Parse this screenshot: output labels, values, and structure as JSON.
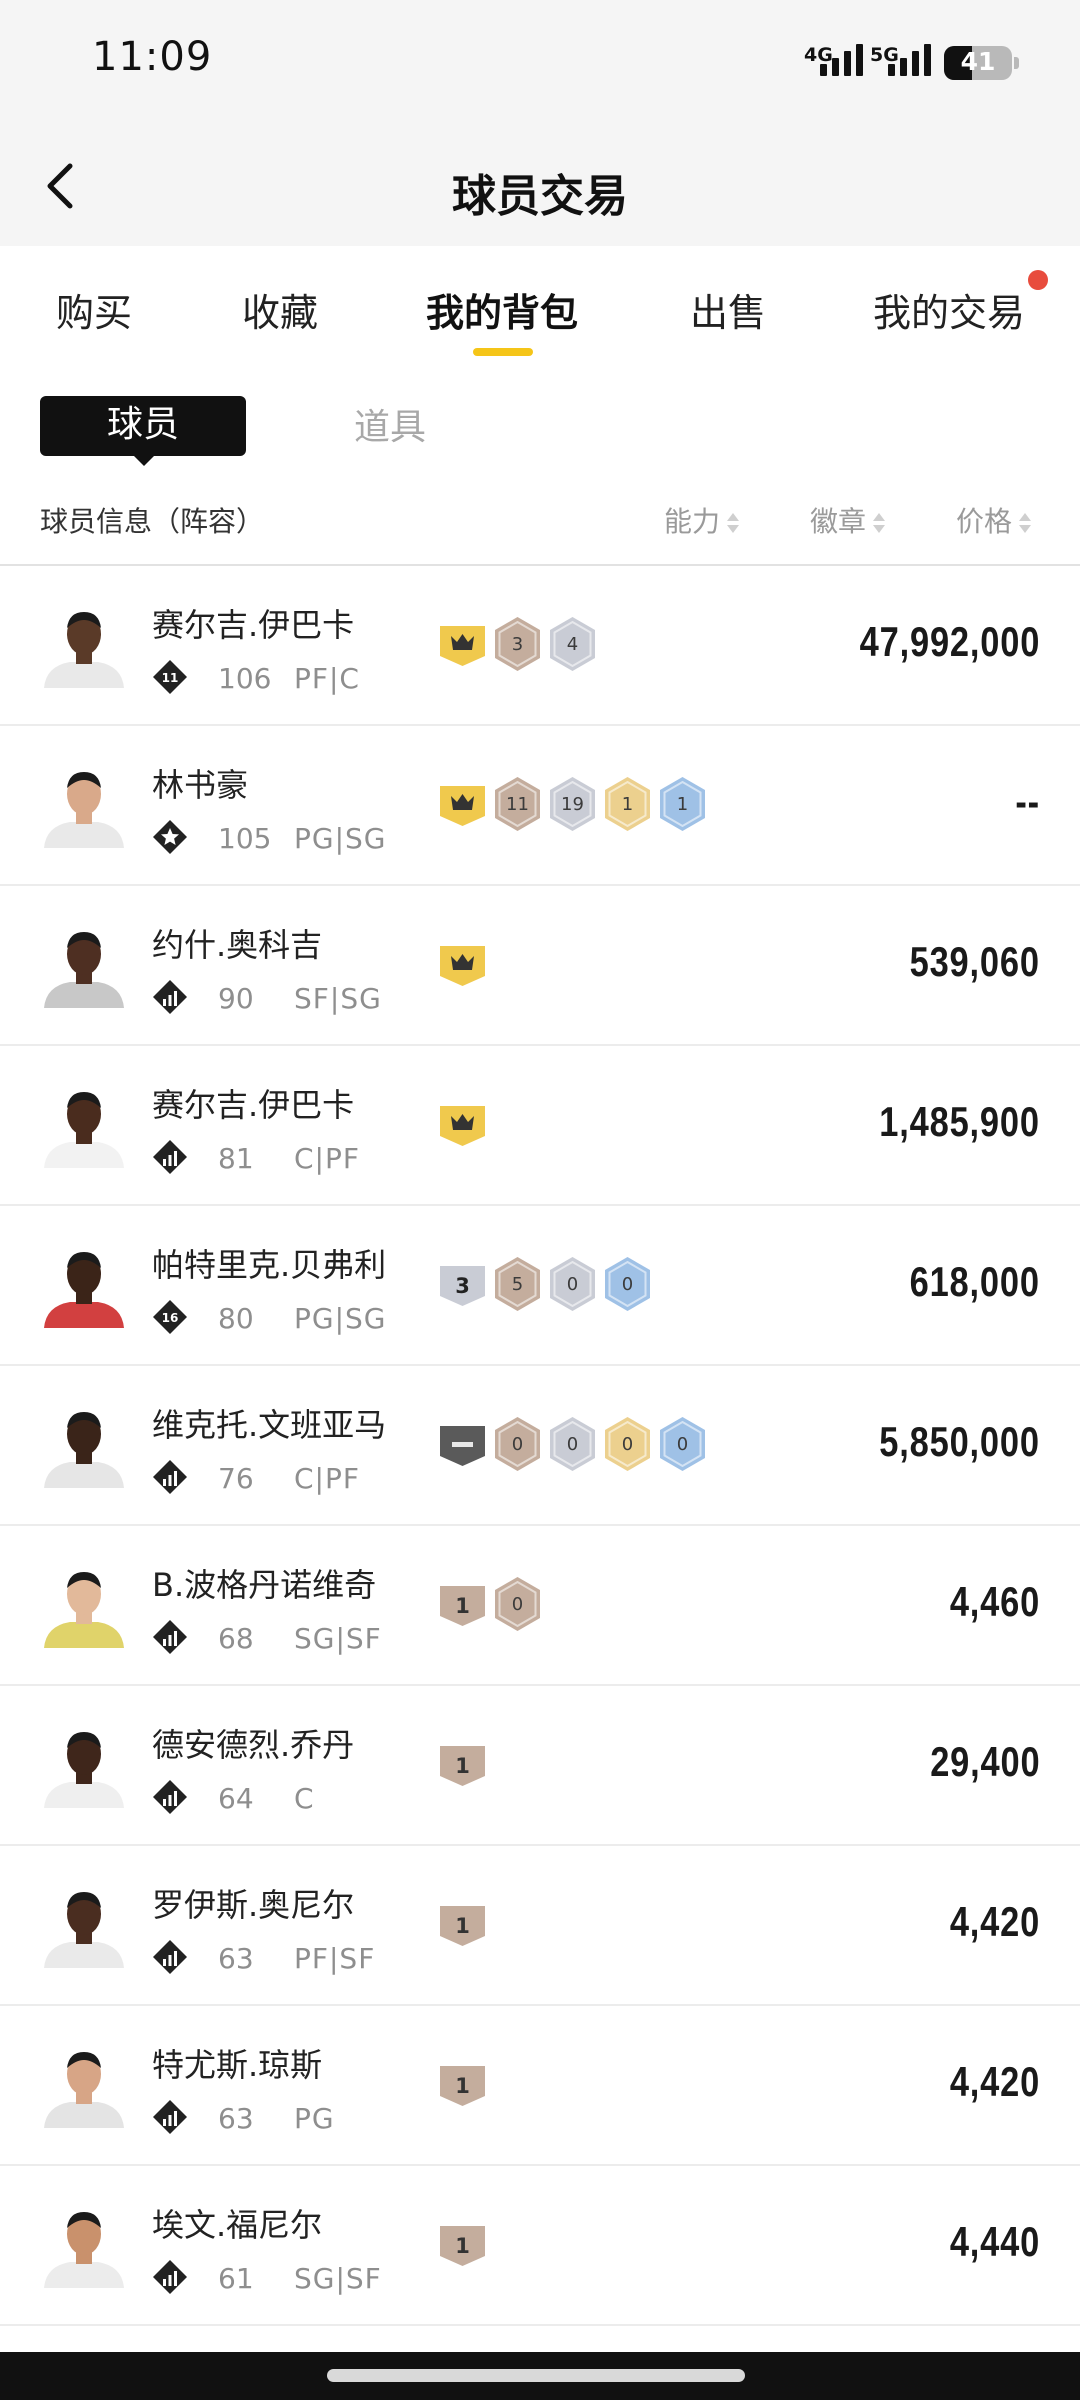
{
  "status": {
    "time": "11:09",
    "net1": "4G",
    "net2": "5G",
    "battery": "41",
    "battery_level": 0.41
  },
  "nav": {
    "title": "球员交易"
  },
  "tabs": [
    "购买",
    "收藏",
    "我的背包",
    "出售",
    "我的交易"
  ],
  "active_tab": "我的背包",
  "segment": {
    "active": "球员",
    "inactive": "道具"
  },
  "table_header": {
    "info": "球员信息（阵容）",
    "ability": "能力",
    "badge": "徽章",
    "price": "价格"
  },
  "colors": {
    "accent": "#f5c518",
    "notify_dot": "#e84c3d",
    "gold": "#f0c94d",
    "bronze": "#c4ad9d",
    "silver": "#c9ccd5",
    "hof_gold": "#ecd08e",
    "blue": "#9fc1e6"
  },
  "players": [
    {
      "name": "赛尔吉.伊巴卡",
      "rating": "106",
      "pos": "PF|C",
      "tier": "diamond-11",
      "tier_label": "11",
      "badges": [
        {
          "type": "crown"
        },
        {
          "type": "bronze",
          "label": "3"
        },
        {
          "type": "silver",
          "label": "4"
        }
      ],
      "price": "47,992,000",
      "skin": "#5a3a28",
      "jersey": "#e9e9e9"
    },
    {
      "name": "林书豪",
      "rating": "105",
      "pos": "PG|SG",
      "tier": "star",
      "tier_label": "",
      "badges": [
        {
          "type": "crown"
        },
        {
          "type": "bronze",
          "label": "11"
        },
        {
          "type": "silver",
          "label": "19"
        },
        {
          "type": "gold",
          "label": "1"
        },
        {
          "type": "blue",
          "label": "1"
        }
      ],
      "price": "--",
      "skin": "#d9a98a",
      "jersey": "#e9e9e9"
    },
    {
      "name": "约什.奥科吉",
      "rating": "90",
      "pos": "SF|SG",
      "tier": "bars",
      "tier_label": "",
      "badges": [
        {
          "type": "crown"
        }
      ],
      "price": "539,060",
      "skin": "#4e2f22",
      "jersey": "#c8c8c8"
    },
    {
      "name": "赛尔吉.伊巴卡",
      "rating": "81",
      "pos": "C|PF",
      "tier": "bars",
      "tier_label": "",
      "badges": [
        {
          "type": "crown"
        }
      ],
      "price": "1,485,900",
      "skin": "#4a2c1e",
      "jersey": "#f2f2f2"
    },
    {
      "name": "帕特里克.贝弗利",
      "rating": "80",
      "pos": "PG|SG",
      "tier": "diamond-16",
      "tier_label": "16",
      "badges": [
        {
          "type": "grade",
          "label": "3"
        },
        {
          "type": "bronze",
          "label": "5"
        },
        {
          "type": "silver",
          "label": "0"
        },
        {
          "type": "blue",
          "label": "0"
        }
      ],
      "price": "618,000",
      "skin": "#3b2418",
      "jersey": "#d24040"
    },
    {
      "name": "维克托.文班亚马",
      "rating": "76",
      "pos": "C|PF",
      "tier": "bars",
      "tier_label": "",
      "badges": [
        {
          "type": "dark"
        },
        {
          "type": "bronze",
          "label": "0"
        },
        {
          "type": "silver",
          "label": "0"
        },
        {
          "type": "gold",
          "label": "0"
        },
        {
          "type": "blue",
          "label": "0"
        }
      ],
      "price": "5,850,000",
      "skin": "#3a2419",
      "jersey": "#e6e6e6"
    },
    {
      "name": "B.波格丹诺维奇",
      "rating": "68",
      "pos": "SG|SF",
      "tier": "bars",
      "tier_label": "",
      "badges": [
        {
          "type": "grade-bronze",
          "label": "1"
        },
        {
          "type": "bronze",
          "label": "0"
        }
      ],
      "price": "4,460",
      "skin": "#e2b99a",
      "jersey": "#e0d36a"
    },
    {
      "name": "德安德烈.乔丹",
      "rating": "64",
      "pos": "C",
      "tier": "bars",
      "tier_label": "",
      "badges": [
        {
          "type": "grade-bronze",
          "label": "1"
        }
      ],
      "price": "29,400",
      "skin": "#3f261b",
      "jersey": "#efefef"
    },
    {
      "name": "罗伊斯.奥尼尔",
      "rating": "63",
      "pos": "PF|SF",
      "tier": "bars",
      "tier_label": "",
      "badges": [
        {
          "type": "grade-bronze",
          "label": "1"
        }
      ],
      "price": "4,420",
      "skin": "#4a2d20",
      "jersey": "#eaeaea"
    },
    {
      "name": "特尤斯.琼斯",
      "rating": "63",
      "pos": "PG",
      "tier": "bars",
      "tier_label": "",
      "badges": [
        {
          "type": "grade-bronze",
          "label": "1"
        }
      ],
      "price": "4,420",
      "skin": "#d7a586",
      "jersey": "#e4e4e4"
    },
    {
      "name": "埃文.福尼尔",
      "rating": "61",
      "pos": "SG|SF",
      "tier": "bars",
      "tier_label": "",
      "badges": [
        {
          "type": "grade-bronze",
          "label": "1"
        }
      ],
      "price": "4,440",
      "skin": "#c9916c",
      "jersey": "#ececec"
    }
  ]
}
